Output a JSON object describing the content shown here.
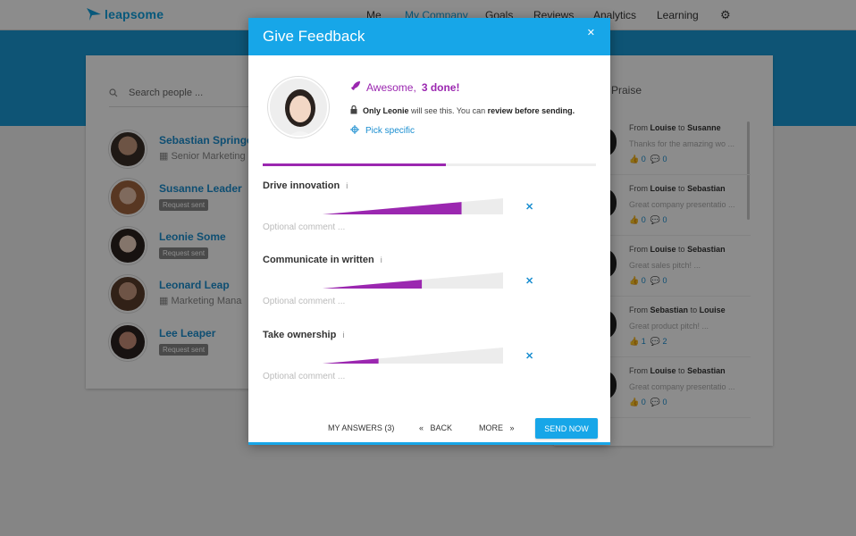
{
  "app": {
    "logo_text": "leapsome",
    "accent": "#17a6e8",
    "purple": "#9b27b0"
  },
  "nav": {
    "items": [
      "Me",
      "My Company",
      "Goals",
      "Reviews",
      "Analytics",
      "Learning"
    ],
    "active": "My Company"
  },
  "people": {
    "search_placeholder": "Search people ...",
    "list": [
      {
        "name": "Sebastian Springer",
        "sub": "Senior Marketing",
        "sub_type": "title"
      },
      {
        "name": "Susanne Leader",
        "sub": "Request sent",
        "sub_type": "badge"
      },
      {
        "name": "Leonie Some",
        "sub": "Request sent",
        "sub_type": "badge"
      },
      {
        "name": "Leonard Leap",
        "sub": "Marketing Mana",
        "sub_type": "title"
      },
      {
        "name": "Lee Leaper",
        "sub": "Request sent",
        "sub_type": "badge"
      }
    ]
  },
  "praise": {
    "title": "Praise",
    "items": [
      {
        "prefix": "From",
        "from": "Louise",
        "mid": "to",
        "to": "Susanne",
        "text": "Thanks for the amazing wo ...",
        "likes": "0",
        "comments": "0"
      },
      {
        "prefix": "From",
        "from": "Louise",
        "mid": "to",
        "to": "Sebastian",
        "text": "Great company presentatio ...",
        "likes": "0",
        "comments": "0"
      },
      {
        "prefix": "From",
        "from": "Louise",
        "mid": "to",
        "to": "Sebastian",
        "text": "Great sales pitch! ...",
        "likes": "0",
        "comments": "0"
      },
      {
        "prefix": "From",
        "from": "Sebastian",
        "mid": "to",
        "to": "Louise",
        "text": "Great product pitch! ...",
        "likes": "1",
        "comments": "2"
      },
      {
        "prefix": "From",
        "from": "Louise",
        "mid": "to",
        "to": "Sebastian",
        "text": "Great company presentatio ...",
        "likes": "0",
        "comments": "0"
      }
    ]
  },
  "modal": {
    "title": "Give Feedback",
    "close_icon": "close-icon",
    "awesome_prefix": "Awesome,",
    "awesome_count": "3 done!",
    "only_bold": "Only Leonie",
    "only_mid": "will see this. You can",
    "only_bold2": "review before sending.",
    "pick_label": "Pick specific",
    "progress": 0.55,
    "questions": [
      {
        "label": "Drive innovation",
        "info": "i",
        "value": 0.77,
        "comment_placeholder": "Optional comment ..."
      },
      {
        "label": "Communicate in written",
        "info": "i",
        "value": 0.55,
        "comment_placeholder": "Optional comment ..."
      },
      {
        "label": "Take ownership",
        "info": "i",
        "value": 0.31,
        "comment_placeholder": "Optional comment ..."
      }
    ],
    "footer": {
      "my_answers": "MY ANSWERS (3)",
      "back": "BACK",
      "more": "MORE",
      "send": "SEND NOW"
    }
  }
}
